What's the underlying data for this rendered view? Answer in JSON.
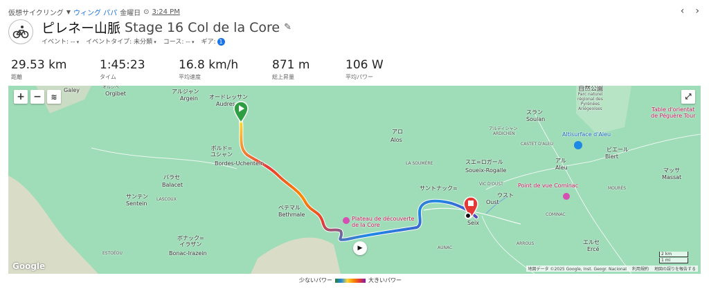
{
  "breadcrumb": {
    "activity_type": "仮想サイクリング",
    "user": "ウィング パパ",
    "day": "金曜日",
    "time": "3:24 PM"
  },
  "nav": {
    "prev": "‹",
    "next": "›"
  },
  "title": {
    "main": "ピレネー山脈",
    "stage": "Stage 16 Col de la Core"
  },
  "meta": {
    "event": "イベント: --",
    "event_type": "イベントタイプ: 未分類",
    "course": "コース: --",
    "gear": "ギア:",
    "gear_count": "1"
  },
  "stats": [
    {
      "value": "29.53 km",
      "label": "距離"
    },
    {
      "value": "1:45:23",
      "label": "タイム"
    },
    {
      "value": "16.8 km/h",
      "label": "平均速度"
    },
    {
      "value": "871 m",
      "label": "総上昇量"
    },
    {
      "value": "106 W",
      "label": "平均パワー"
    }
  ],
  "map": {
    "zoom_in": "+",
    "zoom_out": "−",
    "places": {
      "galey": "Galey",
      "orgibet_jp": "オルジベ",
      "orgibet": "Orgibet",
      "argein_jp": "アルジャン",
      "argein": "Argein",
      "audressein_jp": "オードレッサン",
      "audressein": "Audressein",
      "natpark": "自然公園",
      "natpark_sub": "Parc naturel\nrégional des\nPyrénées\nAriégeoises",
      "table": "Table d'orientat\nde Péguère Tour",
      "soulan_jp": "スラン",
      "soulan": "Soulan",
      "ardichen": "ARDICHEN",
      "castet": "CASTET D'ALEU",
      "altisurface": "Altisurface d'Aleu",
      "bordes_jp": "ボルド=\nユシャン",
      "bordes": "Bordes-Uchentein",
      "alos_jp": "アロ",
      "alos": "Alos",
      "soumere": "LA SOUMÈRE",
      "soueix_jp": "スエ=ロガール",
      "soueix": "Soueix-Rogalle",
      "vic": "VIC D'OUST",
      "aleu_jp": "アル",
      "aleu": "Aleu",
      "biert_jp": "ビエール",
      "biert": "Biert",
      "massat_jp": "マッサ",
      "massat": "Massat",
      "balacet_jp": "バラセ",
      "balacet": "Balacet",
      "lascoux": "LASCOUX",
      "cominac_pt": "Point de vue Cominac",
      "moures": "MOURÈS",
      "oust_jp": "ウスト",
      "oust": "Oust",
      "ercelanne": "サントナック=",
      "sentein_jp": "サンテン",
      "sentein": "Sentein",
      "bethmale_jp": "ベテマル",
      "bethmale": "Bethmale",
      "plateau": "Plateau de découverte\nde la Core",
      "seix": "Seix",
      "cominac": "COMINAC",
      "bonac_jp": "ボナック=\nイラザン",
      "bonac": "Bonac-Irazein",
      "estoeou": "ESTOÉOU",
      "aunac": "AUNAC",
      "arrous": "ARROUS",
      "erce_jp": "エルセ",
      "erce": "Ercé"
    },
    "google": "Google",
    "attribution": "地図データ ©2025 Google, Inst. Geogr. Nacional",
    "terms": "利用規約",
    "report": "地図の誤りを報告する",
    "scale_km": "2 km",
    "scale_mi": "1 mi"
  },
  "legend": {
    "low": "少ないパワー",
    "high": "大きいパワー"
  },
  "colors": {
    "map_green": "#9fdcb8",
    "start": "#2e9e43",
    "finish": "#e53935",
    "link": "#1a73e8"
  }
}
